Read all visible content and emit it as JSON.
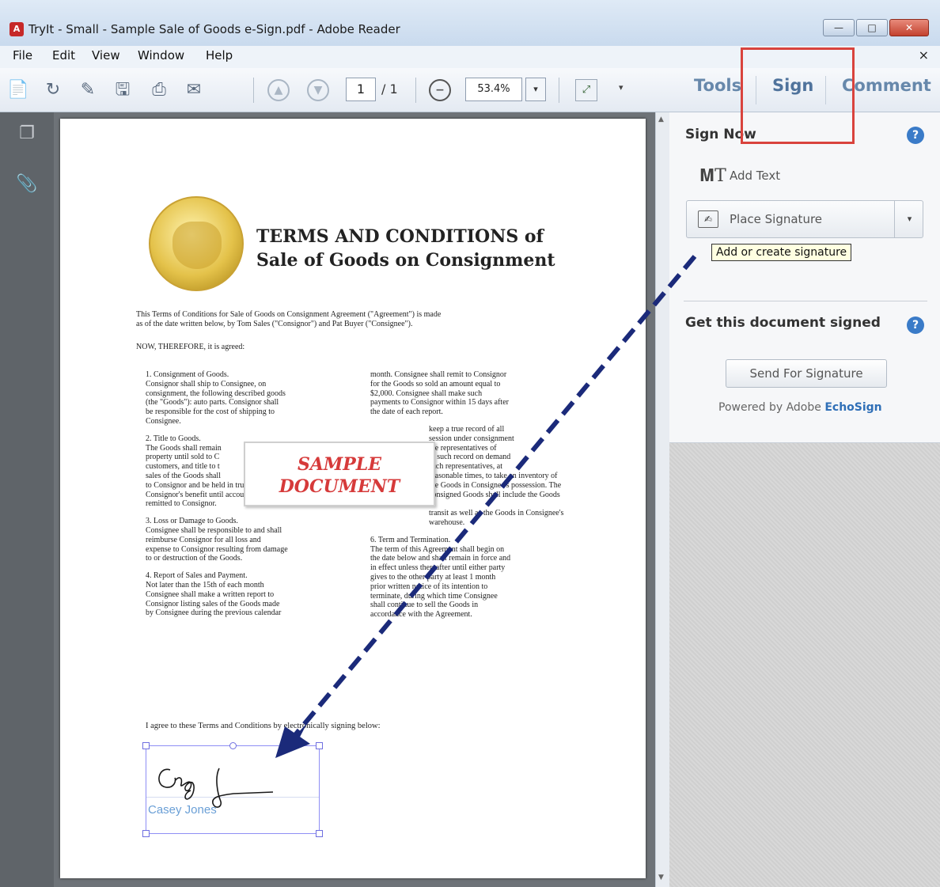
{
  "window": {
    "title": "TryIt - Small - Sample Sale of Goods e-Sign.pdf - Adobe Reader",
    "icon": "adobe-reader-icon",
    "minimize": "—",
    "maximize": "□",
    "close": "✕"
  },
  "menu": {
    "items": [
      "File",
      "Edit",
      "View",
      "Window",
      "Help"
    ],
    "close": "×"
  },
  "toolbar": {
    "page_current": "1",
    "page_total": "/ 1",
    "zoom": "53.4%",
    "tabs": {
      "tools": "Tools",
      "sign": "Sign",
      "comment": "Comment"
    }
  },
  "document": {
    "title_line1": "TERMS AND CONDITIONS of",
    "title_line2": "Sale of Goods on Consignment",
    "intro_line1": "This Terms of Conditions for Sale of Goods on Consignment Agreement (\"Agreement\") is made",
    "intro_line2": "as of the date written below, by Tom Sales (\"Consignor\") and Pat Buyer (\"Consignee\").",
    "now_therefore": "NOW, THEREFORE, it is agreed:",
    "left_column": [
      "1. Consignment of Goods.\nConsignor shall ship to Consignee, on\nconsignment, the following described goods\n(the \"Goods\"): auto parts. Consignor shall\nbe responsible for the cost of shipping to\nConsignee.",
      "2. Title to Goods.\nThe Goods shall remain\nproperty until sold to C\ncustomers, and title to t\nsales of the Goods shall\nto Consignor and be held in trust for\nConsignor's benefit until accounted for and\nremitted to Consignor.",
      "3. Loss or Damage to Goods.\nConsignee shall be responsible to and shall\nreimburse Consignor for all loss and\nexpense to Consignor resulting from damage\nto or destruction of the Goods.",
      "4. Report of Sales and Payment.\nNot later than the 15th of each month\nConsignee shall make a written report to\nConsignor listing sales of the Goods made\nby Consignee during the previous calendar"
    ],
    "right_column": [
      "month. Consignee shall remit to Consignor\nfor the Goods so sold an amount equal to\n$2,000. Consignee shall make such\npayments to Consignor within 15 days after\nthe date of each report.",
      "keep a true record of all\nsession under consignment\nthe representatives of\nto such record on demand\nsuch representatives, at\nreasonable times, to take an inventory of\nthe Goods in Consignee's possession. The\nconsigned Goods shall include the Goods in\ntransit as well as the Goods in Consignee's\nwarehouse.",
      "6. Term and Termination.\nThe term of this Agreement shall begin on\nthe date below and shall remain in force and\nin effect unless thereafter until either party\ngives to the other party at least 1 month\nprior written notice of its intention to\nterminate, during which time Consignee\nshall continue to sell the Goods in\naccordance with the Agreement."
    ],
    "sample_line1": "SAMPLE",
    "sample_line2": "DOCUMENT",
    "agree_text": "I agree to these Terms and Conditions by electronically signing below:",
    "signature_name": "Casey Jones"
  },
  "sign_panel": {
    "sign_now_title": "Sign Now",
    "add_text": "Add Text",
    "place_signature": "Place Signature",
    "tooltip": "Add or create signature",
    "get_signed_title": "Get this document signed",
    "send_button": "Send For Signature",
    "powered_prefix": "Powered by Adobe ",
    "powered_brand": "EchoSign",
    "help": "?"
  },
  "colors": {
    "highlight": "#d9433d",
    "arrow": "#1b2a7a",
    "sample_text": "#d63a3a",
    "signature_text": "#6a9fd6",
    "brand_link": "#2f6fb7"
  }
}
